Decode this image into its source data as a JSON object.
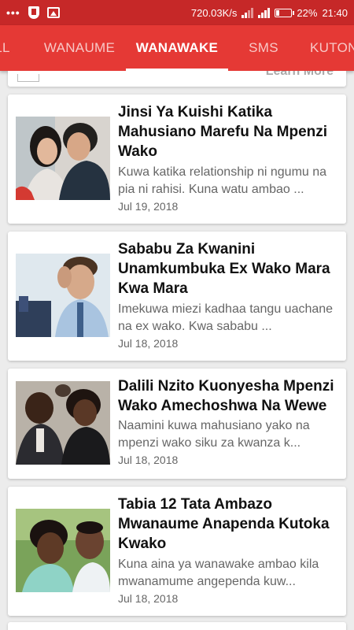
{
  "status_bar": {
    "overflow_icon": "more-dots-icon",
    "speed": "720.03K/s",
    "battery": "22%",
    "battery_level": 0.22,
    "time": "21:40"
  },
  "tabs": [
    {
      "label": "LL",
      "active": false
    },
    {
      "label": "WANAUME",
      "active": false
    },
    {
      "label": "WANAWAKE",
      "active": true
    },
    {
      "label": "SMS",
      "active": false
    },
    {
      "label": "KUTON",
      "active": false
    }
  ],
  "top_card": {
    "partial_text": "Learn More"
  },
  "articles": [
    {
      "title": "Jinsi Ya Kuishi Katika Mahusiano Marefu Na Mpenzi Wako",
      "excerpt": "Kuwa katika relationship ni ngumu na pia ni rahisi. Kuna watu ambao ...",
      "date": "Jul 19, 2018"
    },
    {
      "title": "Sababu Za Kwanini Unamkumbuka Ex Wako Mara Kwa Mara",
      "excerpt": "Imekuwa miezi kadhaa tangu uachane na ex wako. Kwa sababu ...",
      "date": "Jul 18, 2018"
    },
    {
      "title": "Dalili Nzito Kuonyesha Mpenzi Wako Amechoshwa Na Wewe",
      "excerpt": "Naamini kuwa mahusiano yako na mpenzi wako siku za kwanza k...",
      "date": "Jul 18, 2018"
    },
    {
      "title": "Tabia 12 Tata Ambazo Mwanaume Anapenda Kutoka Kwako",
      "excerpt": "Kuna aina ya wanawake ambao kila mwanamume angependa kuw...",
      "date": "Jul 18, 2018"
    }
  ],
  "colors": {
    "status_bar": "#c62828",
    "tab_bar": "#e53935",
    "background": "#ececec"
  }
}
